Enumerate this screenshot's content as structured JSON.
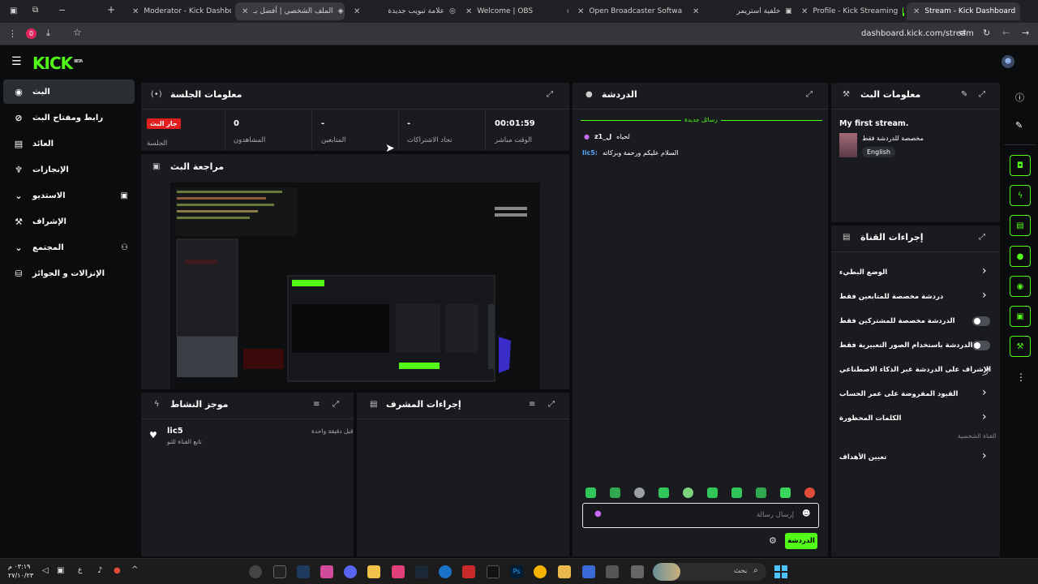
{
  "browser": {
    "tabs": [
      {
        "title": "Moderator - Kick Dashbo",
        "active": false
      },
      {
        "title": "الملف الشخصي | أفضل بـ",
        "active": false
      },
      {
        "title": "علامة تبويب جديدة",
        "active": false
      },
      {
        "title": "Welcome | OBS",
        "active": false
      },
      {
        "title": "Open Broadcaster Softwa",
        "active": false
      },
      {
        "title": "خلفية استريمر",
        "active": false
      },
      {
        "title": "Profile - Kick Streaming",
        "active": false
      },
      {
        "title": "Stream - Kick Dashboard",
        "active": true
      }
    ],
    "badge_count": "0",
    "url": "dashboard.kick.com/stream"
  },
  "header": {
    "logo": "KICK",
    "logo_sup": "BETA"
  },
  "leftnav": {
    "items": [
      {
        "label": "البث",
        "icon": "broadcast-icon",
        "glyph": "((•))",
        "active": true
      },
      {
        "label": "رابط ومفتاح البث",
        "icon": "link-icon",
        "glyph": "⊘"
      },
      {
        "label": "العائد",
        "icon": "chart-icon",
        "glyph": "▤"
      },
      {
        "label": "الإنجازات",
        "icon": "trophy-icon",
        "glyph": "🏆"
      },
      {
        "label": "الاستديو",
        "icon": "studio-icon",
        "glyph": "⌄",
        "right": "▣"
      },
      {
        "label": "الإشراف",
        "icon": "moderation-icon",
        "glyph": "⚒"
      },
      {
        "label": "المجتمع",
        "icon": "community-icon",
        "glyph": "⌄",
        "right": "⚇"
      },
      {
        "label": "الإنزالات و الجوائز",
        "icon": "drops-icon",
        "glyph": "⛁"
      }
    ]
  },
  "session": {
    "title": "معلومات الجلسة",
    "metrics": [
      {
        "label": "الوقت مباشر",
        "value": "00:01:59"
      },
      {
        "label": "تجاد الاشتراكات",
        "value": "-"
      },
      {
        "label": "المتابعين",
        "value": "-"
      },
      {
        "label": "المشاهدون",
        "value": "0"
      },
      {
        "label": "الجلسة",
        "badge": "جار البث"
      }
    ]
  },
  "preview": {
    "title": "مراجعة البث"
  },
  "activity": {
    "title": "موجز النشاط",
    "item": {
      "user": "lic5",
      "desc": "تابع القناة للتو",
      "time": "قبل دقيقة واحدة"
    }
  },
  "modactions": {
    "title": "إجراءات المشرف"
  },
  "chat": {
    "title": "الدردشة",
    "new_messages": "رسائل جديدة",
    "messages": [
      {
        "user": "z1_ل",
        "text": "لحياه"
      },
      {
        "user": "lic5:",
        "text": "السلام عليكم ورحمة وبركاته"
      }
    ],
    "input_placeholder": "إرسال رسالة",
    "send_label": "الدردشة"
  },
  "streaminfo": {
    "title": "معلومات البث",
    "stream_title": "My first stream.",
    "category": "مخصصة للدردشة فقط",
    "language": "English"
  },
  "channelactions": {
    "title": "إجراءات القناة",
    "rows": [
      {
        "label": "الوضع البطيء",
        "control": "chevron"
      },
      {
        "label": "دردشة مخصصة للمتابعين فقط",
        "control": "chevron"
      },
      {
        "label": "الدردشة مخصصة للمشتركين فقط",
        "control": "toggle"
      },
      {
        "label": "الدردشة باستخدام الصور التعبيرية فقط",
        "control": "toggle"
      },
      {
        "label": "الإشراف على الدردشة عبر الذكاء الاصطناعي",
        "control": "external"
      },
      {
        "label": "القيود المفروضة على عمر الحساب",
        "control": "chevron"
      },
      {
        "label": "الكلمات المحظورة",
        "control": "chevron"
      }
    ],
    "section_label": "القناة الشخصية",
    "host_label": "تعيين الأهداف"
  },
  "taskbar": {
    "time": "٠٣:١٩ م",
    "date": "٢٧/١٠/٢٣",
    "search_label": "بحث"
  },
  "colors": {
    "accent": "#53fc18",
    "live": "#e02020",
    "panel": "#191b1f"
  }
}
